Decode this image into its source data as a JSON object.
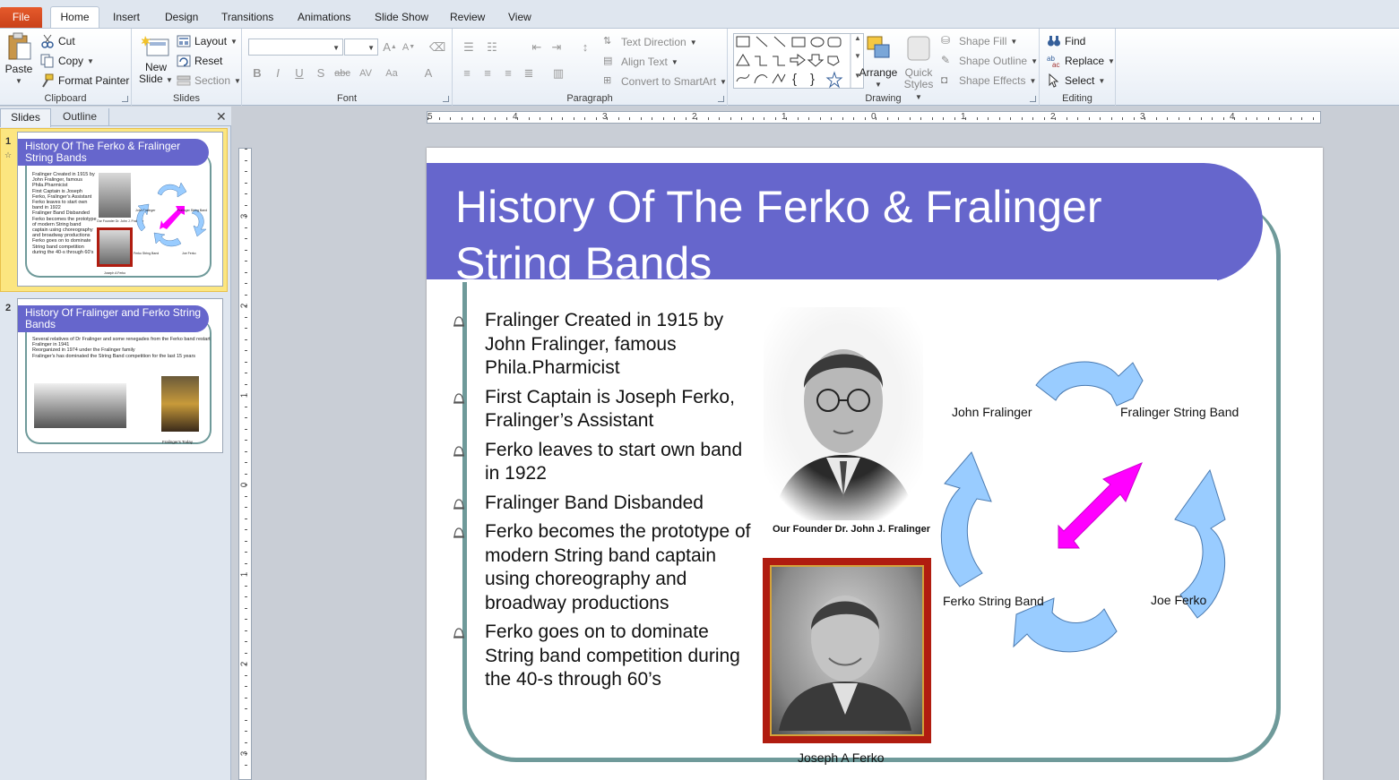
{
  "tabs": {
    "file": "File",
    "home": "Home",
    "insert": "Insert",
    "design": "Design",
    "transitions": "Transitions",
    "animations": "Animations",
    "slideshow": "Slide Show",
    "review": "Review",
    "view": "View"
  },
  "clipboard": {
    "paste": "Paste",
    "cut": "Cut",
    "copy": "Copy",
    "format_painter": "Format Painter",
    "label": "Clipboard"
  },
  "slides_group": {
    "new_slide_1": "New",
    "new_slide_2": "Slide",
    "layout": "Layout",
    "reset": "Reset",
    "section": "Section",
    "label": "Slides"
  },
  "font": {
    "label": "Font",
    "bold": "B",
    "italic": "I",
    "underline": "U",
    "shadow": "S",
    "strike": "abc",
    "spacing": "AV",
    "case": "Aa"
  },
  "paragraph": {
    "label": "Paragraph",
    "text_direction": "Text Direction",
    "align_text": "Align Text",
    "convert_smartart": "Convert to SmartArt"
  },
  "drawing": {
    "label": "Drawing",
    "arrange": "Arrange",
    "quick_styles_1": "Quick",
    "quick_styles_2": "Styles",
    "shape_fill": "Shape Fill",
    "shape_outline": "Shape Outline",
    "shape_effects": "Shape Effects"
  },
  "editing": {
    "label": "Editing",
    "find": "Find",
    "replace": "Replace",
    "select": "Select"
  },
  "pane": {
    "slides_tab": "Slides",
    "outline_tab": "Outline",
    "close": "✕"
  },
  "thumbnails": [
    {
      "number": "1",
      "title": "History Of The Ferko & Fralinger String Bands",
      "bullets": [
        "Fralinger Created in 1915 by John Fralinger, famous Phila.Pharmicist",
        "First Captain is Joseph Ferko, Fralinger's Assistant",
        "Ferko leaves to start own band in 1922",
        "Fralinger Band Disbanded",
        "Ferko becomes the prototype of modern String band captain using choreography and broadway productions",
        "Ferko goes on to dominate String band competition during the 40-s through 60's"
      ],
      "labels": [
        "John Fralinger",
        "Fralinger String Band",
        "Ferko String Band",
        "Joe Ferko",
        "Our Founder Dr. John J. Fralinger",
        "Joseph A Ferko"
      ]
    },
    {
      "number": "2",
      "title": "History Of Fralinger and Ferko String Bands",
      "bullets": [
        "Several relatives of Dr Fralinger and some renegades from the Ferko band restart Fralinger in 1941",
        "Reorganized in 1974 under the Fralinger family",
        "Fralinger's has dominated the String Band competition for the last 15 years"
      ],
      "caption": "Fralinger's Today"
    }
  ],
  "slide": {
    "title": "History Of The Ferko & Fralinger String Bands",
    "bullets": [
      "Fralinger  Created in 1915 by John Fralinger,  famous Phila.Pharmicist",
      "First Captain  is Joseph Ferko, Fralinger’s  Assistant",
      "Ferko leaves to start own band  in 1922",
      "Fralinger  Band Disbanded",
      "Ferko becomes the prototype of modern String band captain using choreography and broadway productions",
      "Ferko goes on to dominate String band competition during  the 40-s through  60’s"
    ],
    "photo1_caption": "Our Founder Dr. John J. Fralinger",
    "photo2_caption": "Joseph A Ferko",
    "cycle": {
      "label_top_left": "John Fralinger",
      "label_top_right": "Fralinger String Band",
      "label_bottom_left": "Ferko String Band",
      "label_bottom_right": "Joe Ferko"
    }
  },
  "ruler": {
    "h_numbers": [
      "5",
      "4",
      "3",
      "2",
      "1",
      "0",
      "1",
      "2",
      "3",
      "4"
    ],
    "v_numbers": [
      "3",
      "2",
      "1",
      "0",
      "1",
      "2",
      "3"
    ]
  },
  "colors": {
    "title_bar": "#6666cc",
    "frame": "#6f9a9a",
    "cycle_arrow": "#99ccff",
    "center_arrow": "#ff00ff",
    "photo_frame": "#b01c10"
  }
}
